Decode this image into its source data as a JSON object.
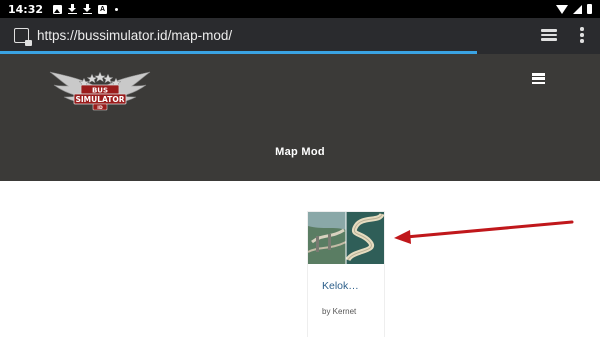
{
  "status_bar": {
    "time": "14:32",
    "icons": [
      "image-icon",
      "download-icon",
      "download-icon",
      "a-icon",
      "dot-icon",
      "wifi-icon",
      "signal-icon",
      "battery-icon"
    ]
  },
  "browser": {
    "url": "https://bussimulator.id/map-mod/",
    "load_progress": 0.795,
    "accent_color": "#3aa3e3"
  },
  "header": {
    "logo_text": [
      "BUS",
      "SIMULATOR",
      "ID"
    ],
    "page_title": "Map Mod",
    "background_color": "#3b3a38"
  },
  "posts": [
    {
      "title": "Kelok…",
      "author": "by Kernet"
    }
  ],
  "annotation": {
    "arrow_color": "#c0171b"
  }
}
